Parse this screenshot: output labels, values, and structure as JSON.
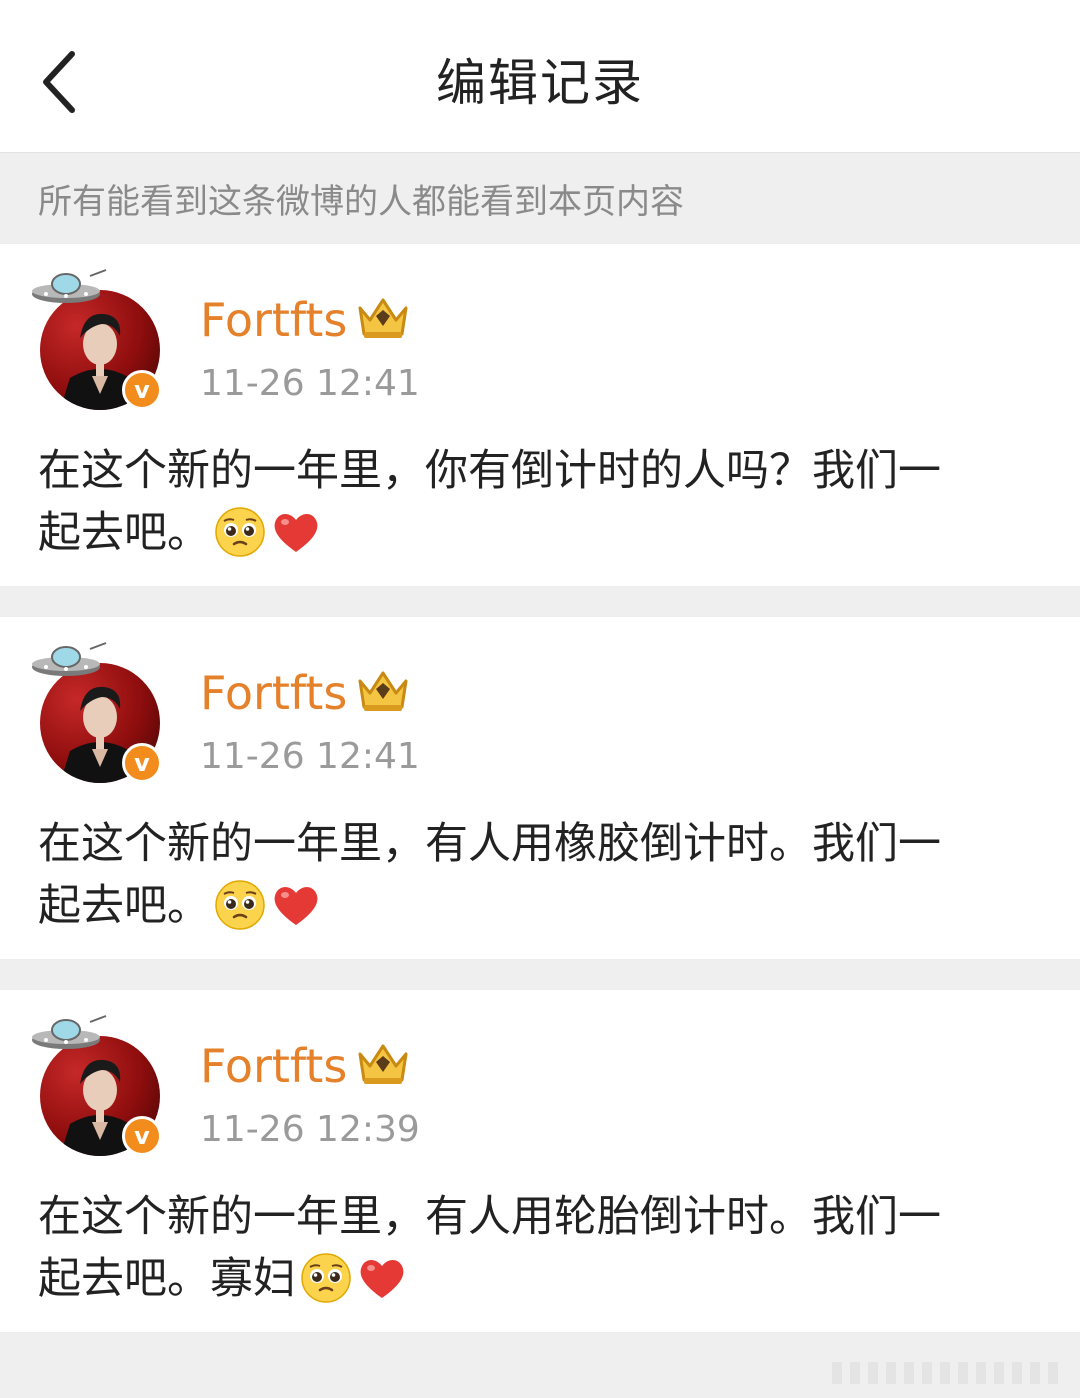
{
  "header": {
    "title": "编辑记录"
  },
  "notice": "所有能看到这条微博的人都能看到本页内容",
  "records": [
    {
      "username": "Fortfts",
      "time": "11-26 12:41",
      "text": "在这个新的一年里，你有倒计时的人吗？我们一\n起去吧。"
    },
    {
      "username": "Fortfts",
      "time": "11-26 12:41",
      "text": "在这个新的一年里，有人用橡胶倒计时。我们一\n起去吧。"
    },
    {
      "username": "Fortfts",
      "time": "11-26 12:39",
      "text": "在这个新的一年里，有人用轮胎倒计时。我们一\n起去吧。寡妇"
    }
  ],
  "icons": {
    "back": "chevron-left-icon",
    "verified": "verified-v-icon",
    "crown": "crown-icon",
    "ufo": "ufo-icon",
    "pleading": "pleading-face-emoji",
    "heart": "red-heart-emoji"
  },
  "colors": {
    "username": "#e5812b",
    "time": "#9a9a9a",
    "badge": "#f28c1c",
    "heart": "#e53935"
  }
}
